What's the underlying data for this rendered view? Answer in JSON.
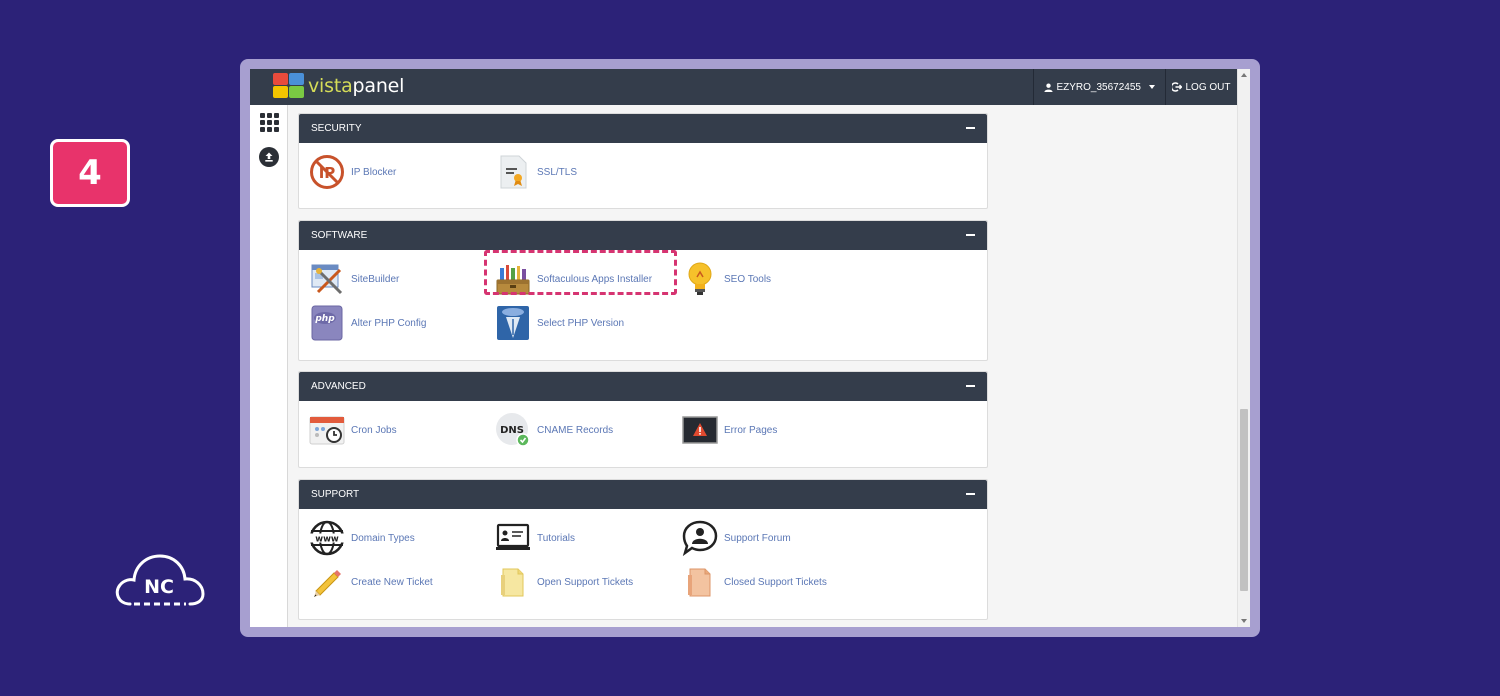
{
  "step": {
    "number": "4"
  },
  "watermark": {
    "text": "NC"
  },
  "brand": {
    "vista": "vista",
    "panel": "panel"
  },
  "topbar": {
    "username": "EZYRO_35672455",
    "logout": "LOG OUT"
  },
  "sections": [
    {
      "title": "SECURITY",
      "items": [
        {
          "label": "IP Blocker",
          "icon": "ip-blocker-icon"
        },
        {
          "label": "SSL/TLS",
          "icon": "certificate-icon"
        }
      ]
    },
    {
      "title": "SOFTWARE",
      "items": [
        {
          "label": "SiteBuilder",
          "icon": "sitebuilder-icon"
        },
        {
          "label": "Softaculous Apps Installer",
          "icon": "softaculous-toolbox-icon"
        },
        {
          "label": "SEO Tools",
          "icon": "lightbulb-icon"
        },
        {
          "label": "Alter PHP Config",
          "icon": "php-config-icon"
        },
        {
          "label": "Select PHP Version",
          "icon": "php-version-icon"
        }
      ]
    },
    {
      "title": "ADVANCED",
      "items": [
        {
          "label": "Cron Jobs",
          "icon": "calendar-clock-icon"
        },
        {
          "label": "CNAME Records",
          "icon": "dns-icon"
        },
        {
          "label": "Error Pages",
          "icon": "error-page-icon"
        }
      ]
    },
    {
      "title": "SUPPORT",
      "items": [
        {
          "label": "Domain Types",
          "icon": "www-globe-icon"
        },
        {
          "label": "Tutorials",
          "icon": "tutorial-monitor-icon"
        },
        {
          "label": "Support Forum",
          "icon": "forum-chat-icon"
        },
        {
          "label": "Create New Ticket",
          "icon": "pencil-icon"
        },
        {
          "label": "Open Support Tickets",
          "icon": "open-folder-icon"
        },
        {
          "label": "Closed Support Tickets",
          "icon": "closed-folder-icon"
        }
      ]
    }
  ],
  "colors": {
    "background": "#2c2278",
    "frame": "#a79fd0",
    "header": "#343d4b",
    "badge": "#e8336b",
    "highlight": "#d63471",
    "link": "#5b77b5"
  }
}
